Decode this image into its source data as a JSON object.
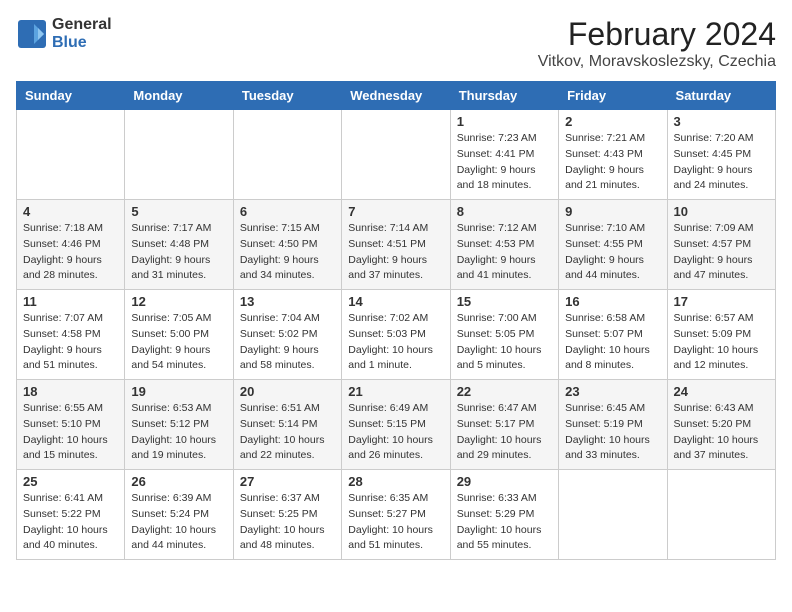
{
  "header": {
    "logo_general": "General",
    "logo_blue": "Blue",
    "month_year": "February 2024",
    "location": "Vitkov, Moravskoslezsky, Czechia"
  },
  "weekdays": [
    "Sunday",
    "Monday",
    "Tuesday",
    "Wednesday",
    "Thursday",
    "Friday",
    "Saturday"
  ],
  "weeks": [
    [
      {
        "day": "",
        "info": ""
      },
      {
        "day": "",
        "info": ""
      },
      {
        "day": "",
        "info": ""
      },
      {
        "day": "",
        "info": ""
      },
      {
        "day": "1",
        "info": "Sunrise: 7:23 AM\nSunset: 4:41 PM\nDaylight: 9 hours\nand 18 minutes."
      },
      {
        "day": "2",
        "info": "Sunrise: 7:21 AM\nSunset: 4:43 PM\nDaylight: 9 hours\nand 21 minutes."
      },
      {
        "day": "3",
        "info": "Sunrise: 7:20 AM\nSunset: 4:45 PM\nDaylight: 9 hours\nand 24 minutes."
      }
    ],
    [
      {
        "day": "4",
        "info": "Sunrise: 7:18 AM\nSunset: 4:46 PM\nDaylight: 9 hours\nand 28 minutes."
      },
      {
        "day": "5",
        "info": "Sunrise: 7:17 AM\nSunset: 4:48 PM\nDaylight: 9 hours\nand 31 minutes."
      },
      {
        "day": "6",
        "info": "Sunrise: 7:15 AM\nSunset: 4:50 PM\nDaylight: 9 hours\nand 34 minutes."
      },
      {
        "day": "7",
        "info": "Sunrise: 7:14 AM\nSunset: 4:51 PM\nDaylight: 9 hours\nand 37 minutes."
      },
      {
        "day": "8",
        "info": "Sunrise: 7:12 AM\nSunset: 4:53 PM\nDaylight: 9 hours\nand 41 minutes."
      },
      {
        "day": "9",
        "info": "Sunrise: 7:10 AM\nSunset: 4:55 PM\nDaylight: 9 hours\nand 44 minutes."
      },
      {
        "day": "10",
        "info": "Sunrise: 7:09 AM\nSunset: 4:57 PM\nDaylight: 9 hours\nand 47 minutes."
      }
    ],
    [
      {
        "day": "11",
        "info": "Sunrise: 7:07 AM\nSunset: 4:58 PM\nDaylight: 9 hours\nand 51 minutes."
      },
      {
        "day": "12",
        "info": "Sunrise: 7:05 AM\nSunset: 5:00 PM\nDaylight: 9 hours\nand 54 minutes."
      },
      {
        "day": "13",
        "info": "Sunrise: 7:04 AM\nSunset: 5:02 PM\nDaylight: 9 hours\nand 58 minutes."
      },
      {
        "day": "14",
        "info": "Sunrise: 7:02 AM\nSunset: 5:03 PM\nDaylight: 10 hours\nand 1 minute."
      },
      {
        "day": "15",
        "info": "Sunrise: 7:00 AM\nSunset: 5:05 PM\nDaylight: 10 hours\nand 5 minutes."
      },
      {
        "day": "16",
        "info": "Sunrise: 6:58 AM\nSunset: 5:07 PM\nDaylight: 10 hours\nand 8 minutes."
      },
      {
        "day": "17",
        "info": "Sunrise: 6:57 AM\nSunset: 5:09 PM\nDaylight: 10 hours\nand 12 minutes."
      }
    ],
    [
      {
        "day": "18",
        "info": "Sunrise: 6:55 AM\nSunset: 5:10 PM\nDaylight: 10 hours\nand 15 minutes."
      },
      {
        "day": "19",
        "info": "Sunrise: 6:53 AM\nSunset: 5:12 PM\nDaylight: 10 hours\nand 19 minutes."
      },
      {
        "day": "20",
        "info": "Sunrise: 6:51 AM\nSunset: 5:14 PM\nDaylight: 10 hours\nand 22 minutes."
      },
      {
        "day": "21",
        "info": "Sunrise: 6:49 AM\nSunset: 5:15 PM\nDaylight: 10 hours\nand 26 minutes."
      },
      {
        "day": "22",
        "info": "Sunrise: 6:47 AM\nSunset: 5:17 PM\nDaylight: 10 hours\nand 29 minutes."
      },
      {
        "day": "23",
        "info": "Sunrise: 6:45 AM\nSunset: 5:19 PM\nDaylight: 10 hours\nand 33 minutes."
      },
      {
        "day": "24",
        "info": "Sunrise: 6:43 AM\nSunset: 5:20 PM\nDaylight: 10 hours\nand 37 minutes."
      }
    ],
    [
      {
        "day": "25",
        "info": "Sunrise: 6:41 AM\nSunset: 5:22 PM\nDaylight: 10 hours\nand 40 minutes."
      },
      {
        "day": "26",
        "info": "Sunrise: 6:39 AM\nSunset: 5:24 PM\nDaylight: 10 hours\nand 44 minutes."
      },
      {
        "day": "27",
        "info": "Sunrise: 6:37 AM\nSunset: 5:25 PM\nDaylight: 10 hours\nand 48 minutes."
      },
      {
        "day": "28",
        "info": "Sunrise: 6:35 AM\nSunset: 5:27 PM\nDaylight: 10 hours\nand 51 minutes."
      },
      {
        "day": "29",
        "info": "Sunrise: 6:33 AM\nSunset: 5:29 PM\nDaylight: 10 hours\nand 55 minutes."
      },
      {
        "day": "",
        "info": ""
      },
      {
        "day": "",
        "info": ""
      }
    ]
  ]
}
